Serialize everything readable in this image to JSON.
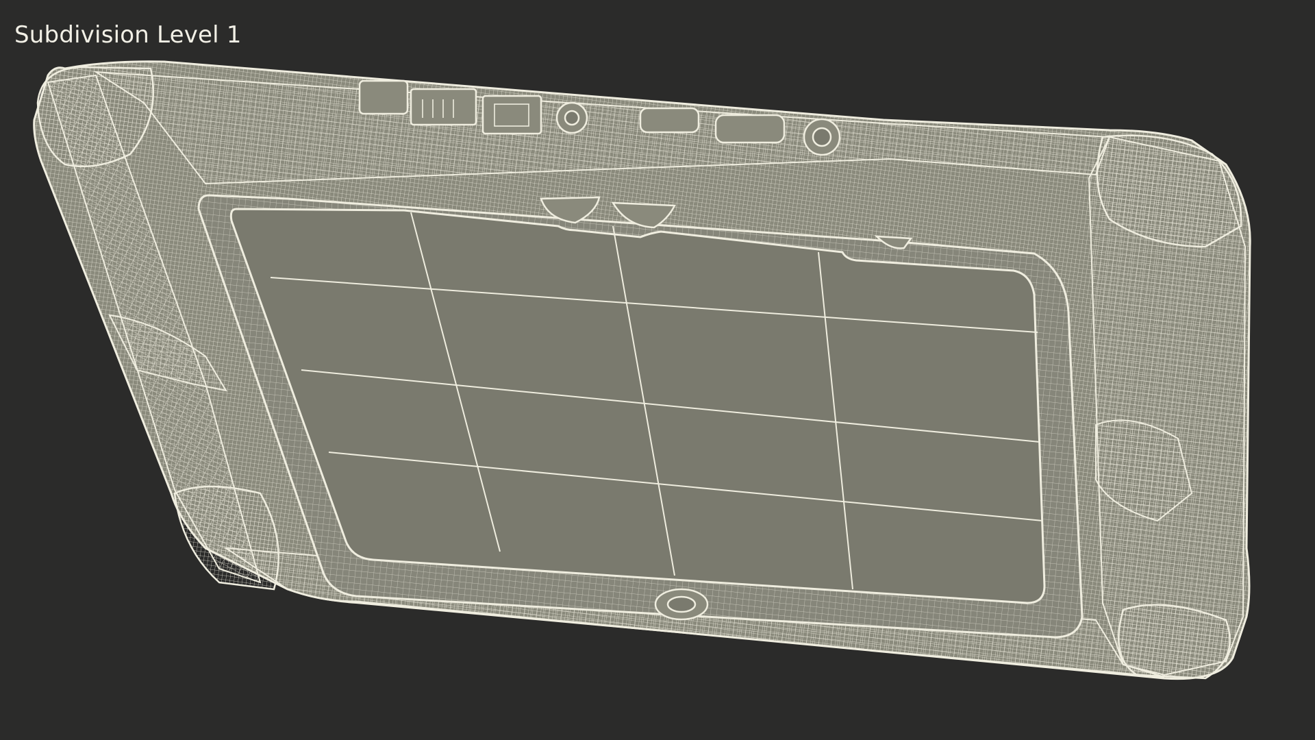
{
  "viewport": {
    "label": "Subdivision Level 1"
  },
  "colors": {
    "background": "#2b2b2a",
    "wire": "#efeddf",
    "screen": "#7a7a6e",
    "bezel": "#8a8a7c",
    "label": "#f2f0e6"
  }
}
